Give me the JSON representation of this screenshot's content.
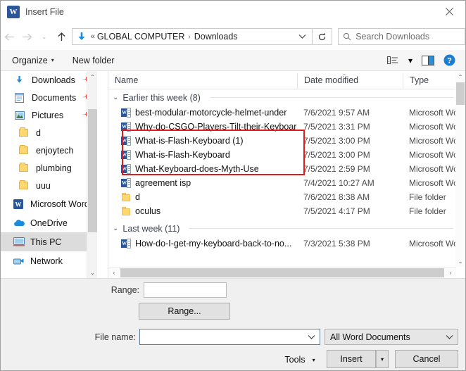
{
  "window": {
    "title": "Insert File",
    "app_icon": "word-icon",
    "close_label": "✕"
  },
  "nav": {
    "back": "←",
    "forward": "→",
    "recent": "⌄",
    "up": "↑",
    "address": {
      "icon": "download-icon",
      "overflow": "«",
      "crumbs": [
        "GLOBAL COMPUTER",
        "Downloads"
      ],
      "separator": "›",
      "dropdown": "⌄"
    },
    "refresh": "↻",
    "search": {
      "placeholder": "Search Downloads",
      "icon": "search-icon"
    }
  },
  "command_bar": {
    "organize": "Organize",
    "new_folder": "New folder",
    "caret": "▾",
    "view_icon": "view-list-icon",
    "view_caret": "▾",
    "pane_icon": "preview-pane-icon",
    "help_icon": "help-icon",
    "help_glyph": "?"
  },
  "sidebar": {
    "items": [
      {
        "label": "Downloads",
        "icon": "download-icon",
        "pinned": true,
        "type": "quick"
      },
      {
        "label": "Documents",
        "icon": "documents-icon",
        "pinned": true,
        "type": "quick"
      },
      {
        "label": "Pictures",
        "icon": "pictures-icon",
        "pinned": true,
        "type": "quick"
      },
      {
        "label": "d",
        "icon": "folder-icon",
        "pinned": false,
        "type": "folder"
      },
      {
        "label": "enjoytech",
        "icon": "folder-icon",
        "pinned": false,
        "type": "folder"
      },
      {
        "label": "plumbing",
        "icon": "folder-icon",
        "pinned": false,
        "type": "folder"
      },
      {
        "label": "uuu",
        "icon": "folder-icon",
        "pinned": false,
        "type": "folder"
      },
      {
        "label": "Microsoft Word",
        "icon": "word-icon",
        "pinned": false,
        "type": "app"
      },
      {
        "label": "OneDrive",
        "icon": "onedrive-icon",
        "pinned": false,
        "type": "cloud"
      },
      {
        "label": "This PC",
        "icon": "thispc-icon",
        "pinned": false,
        "type": "pc",
        "selected": true
      },
      {
        "label": "Network",
        "icon": "network-icon",
        "pinned": false,
        "type": "network"
      }
    ],
    "scroll_up": "⌃",
    "scroll_down": "⌄"
  },
  "file_list": {
    "columns": [
      {
        "label": "Name",
        "sorted": false
      },
      {
        "label": "Date modified",
        "sorted": true,
        "sort_glyph": "⌄"
      },
      {
        "label": "Type",
        "sorted": false
      }
    ],
    "groups": [
      {
        "label": "Earlier this week (8)",
        "chevron": "⌄",
        "rows": [
          {
            "name": "best-modular-motorcycle-helmet-under",
            "date": "7/6/2021 9:57 AM",
            "type": "Microsoft Wo",
            "icon": "word-file-icon",
            "highlighted": true
          },
          {
            "name": "Why-do-CSGO-Players-Tilt-their-Keyboard",
            "date": "7/5/2021 3:31 PM",
            "type": "Microsoft Wo",
            "icon": "word-file-icon",
            "highlighted": true
          },
          {
            "name": "What-is-Flash-Keyboard (1)",
            "date": "7/5/2021 3:00 PM",
            "type": "Microsoft Wo",
            "icon": "word-file-icon",
            "highlighted": true
          },
          {
            "name": "What-is-Flash-Keyboard",
            "date": "7/5/2021 3:00 PM",
            "type": "Microsoft Wo",
            "icon": "word-file-icon",
            "highlighted": false
          },
          {
            "name": "What-Keyboard-does-Myth-Use",
            "date": "7/5/2021 2:59 PM",
            "type": "Microsoft Wo",
            "icon": "word-file-icon",
            "highlighted": false
          },
          {
            "name": "agreement isp",
            "date": "7/4/2021 10:27 AM",
            "type": "Microsoft Wo",
            "icon": "word-file-icon",
            "highlighted": false
          },
          {
            "name": "d",
            "date": "7/6/2021 8:38 AM",
            "type": "File folder",
            "icon": "folder-icon",
            "highlighted": false
          },
          {
            "name": "oculus",
            "date": "7/5/2021 4:17 PM",
            "type": "File folder",
            "icon": "folder-icon",
            "highlighted": false
          }
        ]
      },
      {
        "label": "Last week (11)",
        "chevron": "⌄",
        "rows": [
          {
            "name": "How-do-I-get-my-keyboard-back-to-no...",
            "date": "7/3/2021 5:38 PM",
            "type": "Microsoft Wo",
            "icon": "word-file-icon",
            "highlighted": false
          }
        ]
      }
    ],
    "highlight_color": "#e01b1b",
    "scroll_up": "⌃",
    "scroll_down": "⌄",
    "hscroll_left": "‹",
    "hscroll_right": "›"
  },
  "bottom": {
    "range_label": "Range:",
    "range_value": "",
    "range_button": "Range...",
    "filename_label": "File name:",
    "filename_value": "",
    "filename_dropdown": "⌄",
    "filter_value": "All Word Documents",
    "filter_dropdown": "⌄",
    "tools_label": "Tools",
    "tools_caret": "▾",
    "insert_label": "Insert",
    "insert_caret": "▾",
    "cancel_label": "Cancel"
  }
}
